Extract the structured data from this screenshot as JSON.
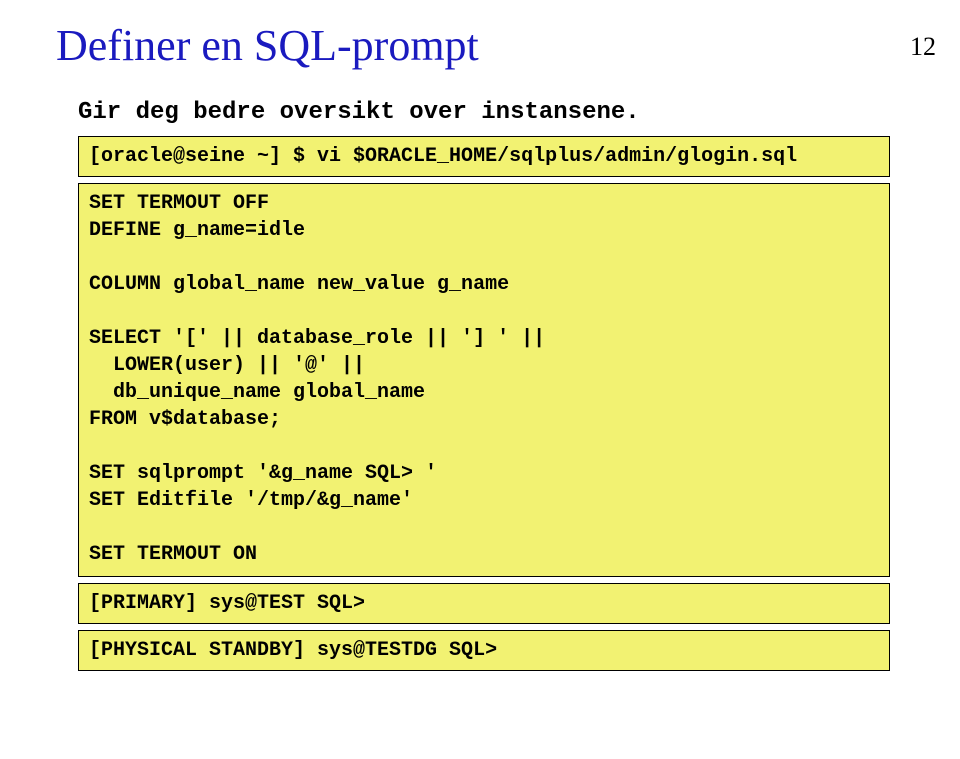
{
  "page_number": "12",
  "title": "Definer en SQL-prompt",
  "subtitle": "Gir deg bedre oversikt over instansene.",
  "code_blocks": {
    "cmd": "[oracle@seine ~] $ vi $ORACLE_HOME/sqlplus/admin/glogin.sql",
    "script": "SET TERMOUT OFF\nDEFINE g_name=idle\n\nCOLUMN global_name new_value g_name\n\nSELECT '[' || database_role || '] ' ||\n  LOWER(user) || '@' ||\n  db_unique_name global_name\nFROM v$database;\n\nSET sqlprompt '&g_name SQL> '\nSET Editfile '/tmp/&g_name'\n\nSET TERMOUT ON",
    "prompt1": "[PRIMARY] sys@TEST SQL>",
    "prompt2": "[PHYSICAL STANDBY] sys@TESTDG SQL>"
  }
}
